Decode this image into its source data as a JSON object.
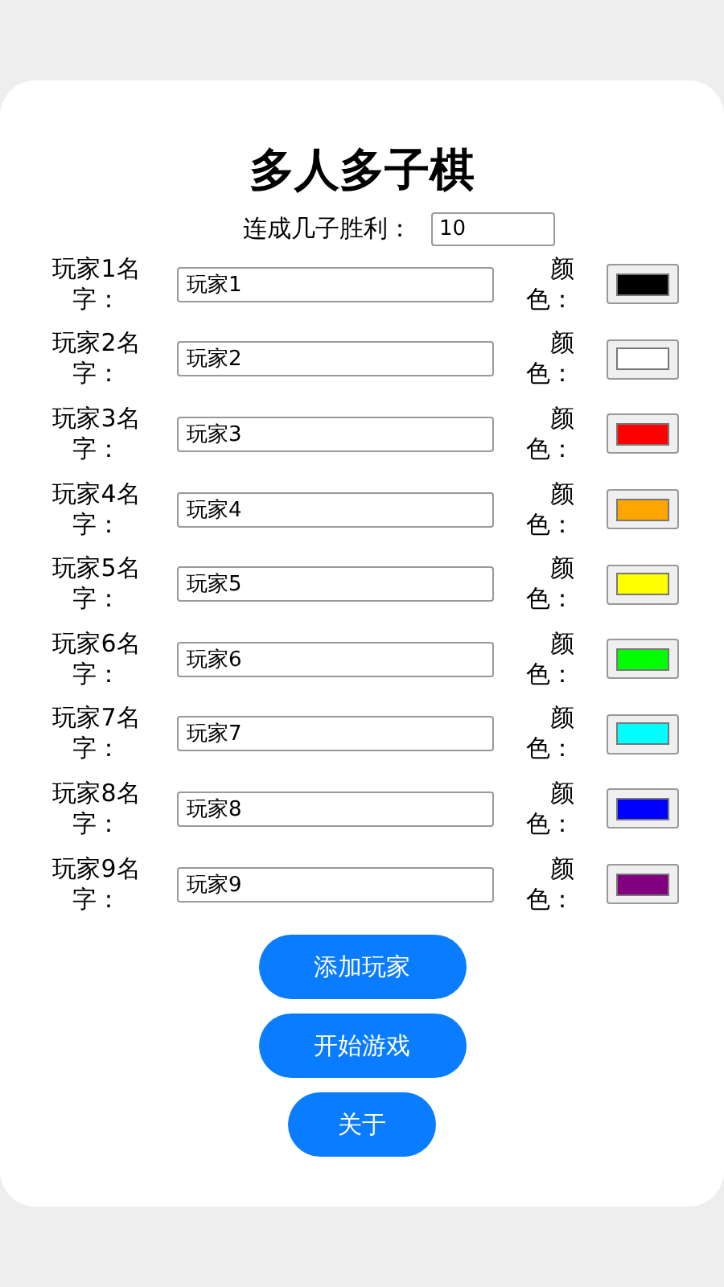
{
  "title": "多人多子棋",
  "win_setting": {
    "label": "连成几子胜利：",
    "value": "10"
  },
  "players": [
    {
      "label": "玩家1名字：",
      "value": "玩家1",
      "color_label": "颜色：",
      "color": "#000000"
    },
    {
      "label": "玩家2名字：",
      "value": "玩家2",
      "color_label": "颜色：",
      "color": "#ffffff"
    },
    {
      "label": "玩家3名字：",
      "value": "玩家3",
      "color_label": "颜色：",
      "color": "#ff0000"
    },
    {
      "label": "玩家4名字：",
      "value": "玩家4",
      "color_label": "颜色：",
      "color": "#ffa500"
    },
    {
      "label": "玩家5名字：",
      "value": "玩家5",
      "color_label": "颜色：",
      "color": "#ffff00"
    },
    {
      "label": "玩家6名字：",
      "value": "玩家6",
      "color_label": "颜色：",
      "color": "#00ff00"
    },
    {
      "label": "玩家7名字：",
      "value": "玩家7",
      "color_label": "颜色：",
      "color": "#00ffff"
    },
    {
      "label": "玩家8名字：",
      "value": "玩家8",
      "color_label": "颜色：",
      "color": "#0000ff"
    },
    {
      "label": "玩家9名字：",
      "value": "玩家9",
      "color_label": "颜色：",
      "color": "#800080"
    }
  ],
  "buttons": [
    {
      "label": "添加玩家",
      "kind": "wide"
    },
    {
      "label": "开始游戏",
      "kind": "wide"
    },
    {
      "label": "关于",
      "kind": "narrow"
    }
  ]
}
